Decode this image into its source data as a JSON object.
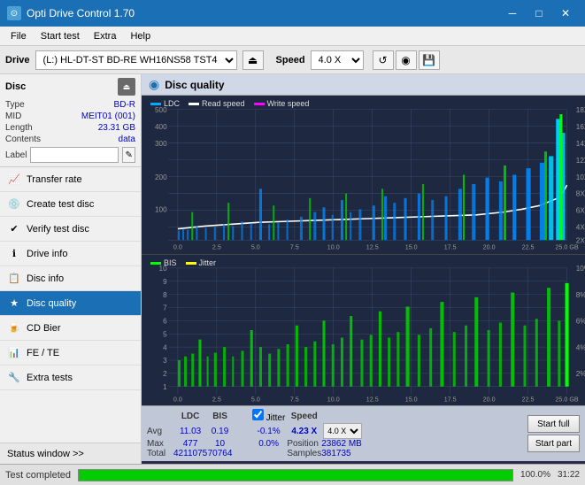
{
  "titleBar": {
    "icon": "⊙",
    "title": "Opti Drive Control 1.70",
    "minimize": "─",
    "maximize": "□",
    "close": "✕"
  },
  "menuBar": {
    "items": [
      "File",
      "Start test",
      "Extra",
      "Help"
    ]
  },
  "driveBar": {
    "label": "Drive",
    "driveValue": "(L:)  HL-DT-ST BD-RE  WH16NS58 TST4",
    "ejectIcon": "⏏",
    "speedLabel": "Speed",
    "speedValue": "4.0 X",
    "icons": [
      "🔄",
      "💿",
      "💾"
    ]
  },
  "disc": {
    "header": "Disc",
    "type_label": "Type",
    "type_val": "BD-R",
    "mid_label": "MID",
    "mid_val": "MEIT01 (001)",
    "length_label": "Length",
    "length_val": "23.31 GB",
    "contents_label": "Contents",
    "contents_val": "data",
    "label_label": "Label",
    "label_val": ""
  },
  "navItems": [
    {
      "id": "transfer-rate",
      "label": "Transfer rate",
      "icon": "📈"
    },
    {
      "id": "create-test-disc",
      "label": "Create test disc",
      "icon": "💿"
    },
    {
      "id": "verify-test-disc",
      "label": "Verify test disc",
      "icon": "✔"
    },
    {
      "id": "drive-info",
      "label": "Drive info",
      "icon": "ℹ"
    },
    {
      "id": "disc-info",
      "label": "Disc info",
      "icon": "📋"
    },
    {
      "id": "disc-quality",
      "label": "Disc quality",
      "icon": "★",
      "active": true
    },
    {
      "id": "cd-bier",
      "label": "CD Bier",
      "icon": "🍺"
    },
    {
      "id": "fe-te",
      "label": "FE / TE",
      "icon": "📊"
    },
    {
      "id": "extra-tests",
      "label": "Extra tests",
      "icon": "🔧"
    }
  ],
  "statusWindow": "Status window >>",
  "discQuality": {
    "title": "Disc quality",
    "legendItems": [
      {
        "label": "LDC",
        "color": "#00aaff"
      },
      {
        "label": "Read speed",
        "color": "#ffffff"
      },
      {
        "label": "Write speed",
        "color": "#ff00ff"
      }
    ],
    "topChart": {
      "yLeftMax": "500",
      "yRightLabels": [
        "18X",
        "16X",
        "14X",
        "12X",
        "10X",
        "8X",
        "6X",
        "4X",
        "2X"
      ],
      "xLabels": [
        "0.0",
        "2.5",
        "5.0",
        "7.5",
        "10.0",
        "12.5",
        "15.0",
        "17.5",
        "20.0",
        "22.5",
        "25.0 GB"
      ]
    },
    "bottomChart": {
      "legendItems": [
        {
          "label": "BIS",
          "color": "#00ff00"
        },
        {
          "label": "Jitter",
          "color": "#ffff00"
        }
      ],
      "yLeftLabels": [
        "10",
        "9",
        "8",
        "7",
        "6",
        "5",
        "4",
        "3",
        "2",
        "1"
      ],
      "yRightLabels": [
        "10%",
        "8%",
        "6%",
        "4%",
        "2%"
      ],
      "xLabels": [
        "0.0",
        "2.5",
        "5.0",
        "7.5",
        "10.0",
        "12.5",
        "15.0",
        "17.5",
        "20.0",
        "22.5",
        "25.0 GB"
      ]
    }
  },
  "stats": {
    "headers": [
      "",
      "LDC",
      "BIS",
      "",
      "Jitter",
      "Speed",
      ""
    ],
    "avgLabel": "Avg",
    "avgLdc": "11.03",
    "avgBis": "0.19",
    "avgJitter": "-0.1%",
    "avgSpeed": "4.23 X",
    "avgSpeedSel": "4.0 X",
    "maxLabel": "Max",
    "maxLdc": "477",
    "maxBis": "10",
    "maxJitter": "0.0%",
    "positionLabel": "Position",
    "positionVal": "23862 MB",
    "totalLabel": "Total",
    "totalLdc": "4211075",
    "totalBis": "70764",
    "samplesLabel": "Samples",
    "samplesVal": "381735",
    "startFull": "Start full",
    "startPart": "Start part",
    "jitterChecked": true,
    "jitterLabel": "Jitter"
  },
  "statusBar": {
    "text": "Test completed",
    "progress": 100,
    "progressText": "100.0%",
    "time": "31:22"
  }
}
